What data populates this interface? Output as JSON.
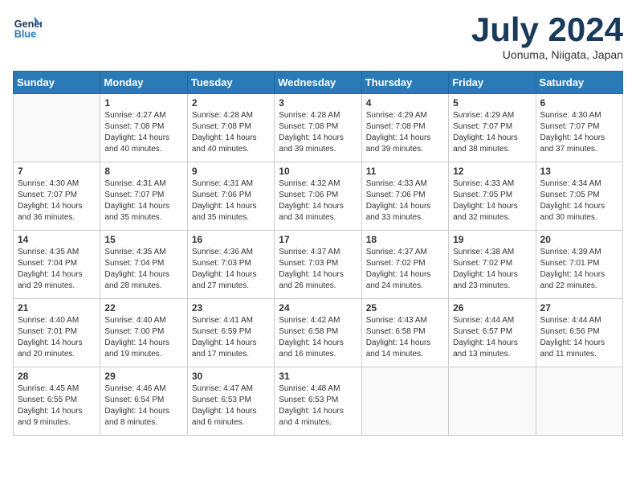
{
  "header": {
    "logo_line1": "General",
    "logo_line2": "Blue",
    "month_title": "July 2024",
    "location": "Uonuma, Niigata, Japan"
  },
  "weekdays": [
    "Sunday",
    "Monday",
    "Tuesday",
    "Wednesday",
    "Thursday",
    "Friday",
    "Saturday"
  ],
  "weeks": [
    [
      {
        "day": "",
        "info": ""
      },
      {
        "day": "1",
        "info": "Sunrise: 4:27 AM\nSunset: 7:08 PM\nDaylight: 14 hours\nand 40 minutes."
      },
      {
        "day": "2",
        "info": "Sunrise: 4:28 AM\nSunset: 7:08 PM\nDaylight: 14 hours\nand 40 minutes."
      },
      {
        "day": "3",
        "info": "Sunrise: 4:28 AM\nSunset: 7:08 PM\nDaylight: 14 hours\nand 39 minutes."
      },
      {
        "day": "4",
        "info": "Sunrise: 4:29 AM\nSunset: 7:08 PM\nDaylight: 14 hours\nand 39 minutes."
      },
      {
        "day": "5",
        "info": "Sunrise: 4:29 AM\nSunset: 7:07 PM\nDaylight: 14 hours\nand 38 minutes."
      },
      {
        "day": "6",
        "info": "Sunrise: 4:30 AM\nSunset: 7:07 PM\nDaylight: 14 hours\nand 37 minutes."
      }
    ],
    [
      {
        "day": "7",
        "info": "Sunrise: 4:30 AM\nSunset: 7:07 PM\nDaylight: 14 hours\nand 36 minutes."
      },
      {
        "day": "8",
        "info": "Sunrise: 4:31 AM\nSunset: 7:07 PM\nDaylight: 14 hours\nand 35 minutes."
      },
      {
        "day": "9",
        "info": "Sunrise: 4:31 AM\nSunset: 7:06 PM\nDaylight: 14 hours\nand 35 minutes."
      },
      {
        "day": "10",
        "info": "Sunrise: 4:32 AM\nSunset: 7:06 PM\nDaylight: 14 hours\nand 34 minutes."
      },
      {
        "day": "11",
        "info": "Sunrise: 4:33 AM\nSunset: 7:06 PM\nDaylight: 14 hours\nand 33 minutes."
      },
      {
        "day": "12",
        "info": "Sunrise: 4:33 AM\nSunset: 7:05 PM\nDaylight: 14 hours\nand 32 minutes."
      },
      {
        "day": "13",
        "info": "Sunrise: 4:34 AM\nSunset: 7:05 PM\nDaylight: 14 hours\nand 30 minutes."
      }
    ],
    [
      {
        "day": "14",
        "info": "Sunrise: 4:35 AM\nSunset: 7:04 PM\nDaylight: 14 hours\nand 29 minutes."
      },
      {
        "day": "15",
        "info": "Sunrise: 4:35 AM\nSunset: 7:04 PM\nDaylight: 14 hours\nand 28 minutes."
      },
      {
        "day": "16",
        "info": "Sunrise: 4:36 AM\nSunset: 7:03 PM\nDaylight: 14 hours\nand 27 minutes."
      },
      {
        "day": "17",
        "info": "Sunrise: 4:37 AM\nSunset: 7:03 PM\nDaylight: 14 hours\nand 26 minutes."
      },
      {
        "day": "18",
        "info": "Sunrise: 4:37 AM\nSunset: 7:02 PM\nDaylight: 14 hours\nand 24 minutes."
      },
      {
        "day": "19",
        "info": "Sunrise: 4:38 AM\nSunset: 7:02 PM\nDaylight: 14 hours\nand 23 minutes."
      },
      {
        "day": "20",
        "info": "Sunrise: 4:39 AM\nSunset: 7:01 PM\nDaylight: 14 hours\nand 22 minutes."
      }
    ],
    [
      {
        "day": "21",
        "info": "Sunrise: 4:40 AM\nSunset: 7:01 PM\nDaylight: 14 hours\nand 20 minutes."
      },
      {
        "day": "22",
        "info": "Sunrise: 4:40 AM\nSunset: 7:00 PM\nDaylight: 14 hours\nand 19 minutes."
      },
      {
        "day": "23",
        "info": "Sunrise: 4:41 AM\nSunset: 6:59 PM\nDaylight: 14 hours\nand 17 minutes."
      },
      {
        "day": "24",
        "info": "Sunrise: 4:42 AM\nSunset: 6:58 PM\nDaylight: 14 hours\nand 16 minutes."
      },
      {
        "day": "25",
        "info": "Sunrise: 4:43 AM\nSunset: 6:58 PM\nDaylight: 14 hours\nand 14 minutes."
      },
      {
        "day": "26",
        "info": "Sunrise: 4:44 AM\nSunset: 6:57 PM\nDaylight: 14 hours\nand 13 minutes."
      },
      {
        "day": "27",
        "info": "Sunrise: 4:44 AM\nSunset: 6:56 PM\nDaylight: 14 hours\nand 11 minutes."
      }
    ],
    [
      {
        "day": "28",
        "info": "Sunrise: 4:45 AM\nSunset: 6:55 PM\nDaylight: 14 hours\nand 9 minutes."
      },
      {
        "day": "29",
        "info": "Sunrise: 4:46 AM\nSunset: 6:54 PM\nDaylight: 14 hours\nand 8 minutes."
      },
      {
        "day": "30",
        "info": "Sunrise: 4:47 AM\nSunset: 6:53 PM\nDaylight: 14 hours\nand 6 minutes."
      },
      {
        "day": "31",
        "info": "Sunrise: 4:48 AM\nSunset: 6:53 PM\nDaylight: 14 hours\nand 4 minutes."
      },
      {
        "day": "",
        "info": ""
      },
      {
        "day": "",
        "info": ""
      },
      {
        "day": "",
        "info": ""
      }
    ]
  ]
}
